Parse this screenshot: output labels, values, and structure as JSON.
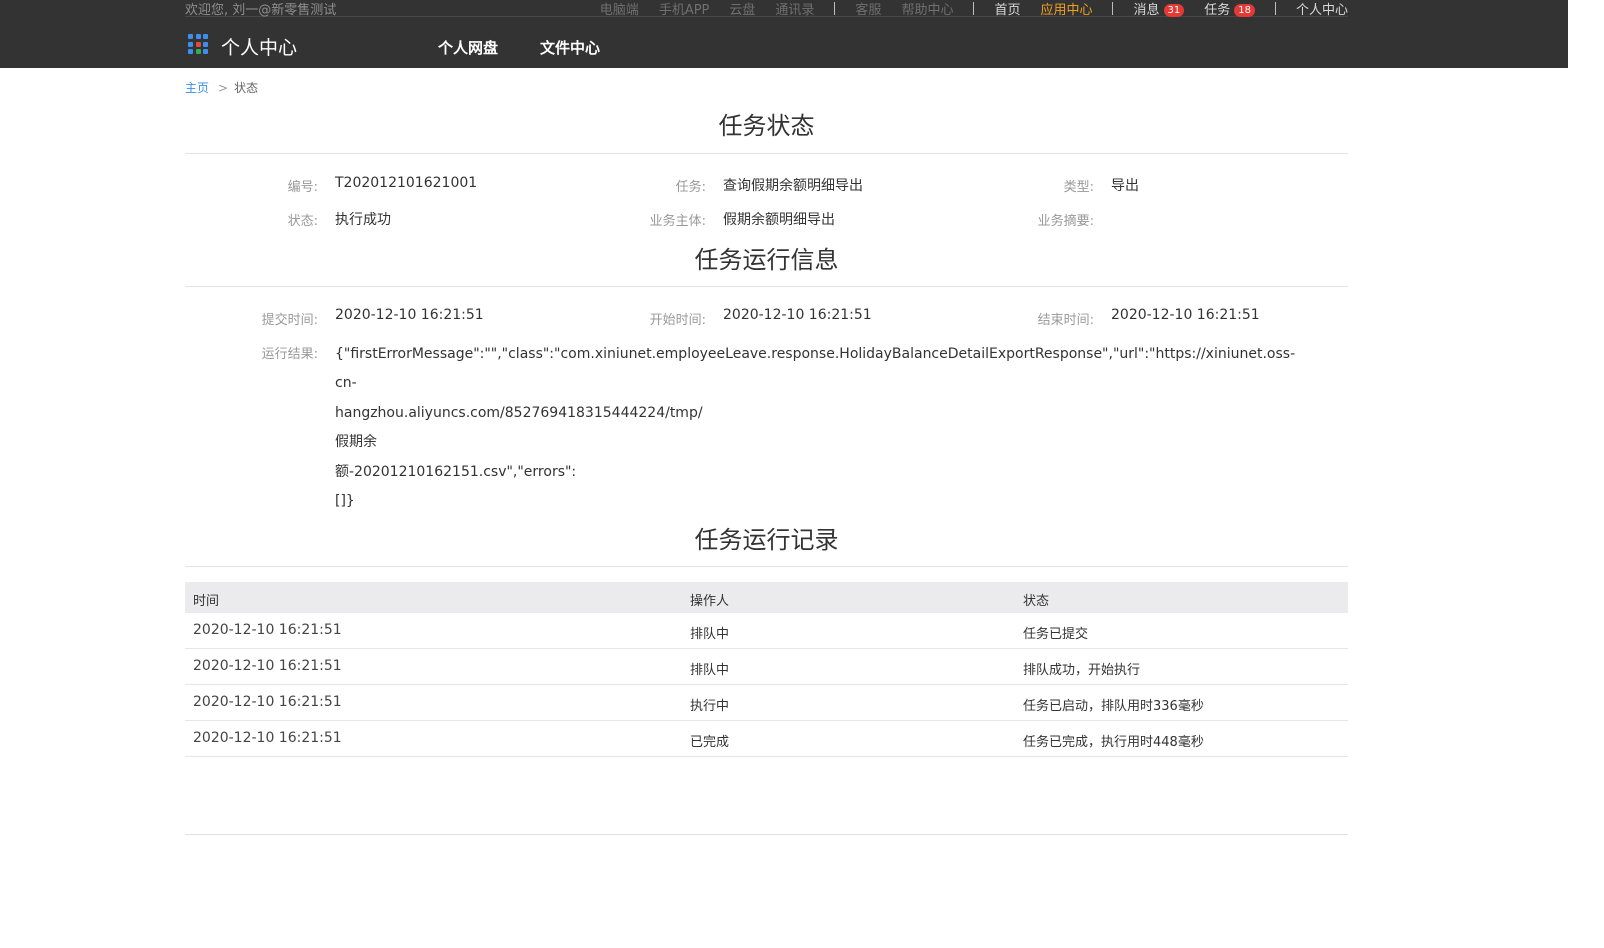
{
  "topbar": {
    "welcome": "欢迎您, 刘一@新零售测试",
    "links": {
      "desktop": "电脑端",
      "mobile_app": "手机APP",
      "cloud_disk": "云盘",
      "contacts": "通讯录",
      "service": "客服",
      "help": "帮助中心",
      "home": "首页",
      "app_center": "应用中心",
      "messages": "消息",
      "messages_count": "31",
      "tasks": "任务",
      "tasks_count": "18",
      "personal_center": "个人中心"
    },
    "accent_color": "#f0a020",
    "badge_color": "#e53935"
  },
  "navbar": {
    "brand": "个人中心",
    "logo_icon": "app-grid-icon",
    "items": [
      "个人网盘",
      "文件中心"
    ]
  },
  "breadcrumb": {
    "home": "主页",
    "separator": ">",
    "current": "状态"
  },
  "task_status": {
    "title": "任务状态",
    "id_label": "编号:",
    "id_value": "T202012101621001",
    "task_label": "任务:",
    "task_value": "查询假期余额明细导出",
    "type_label": "类型:",
    "type_value": "导出",
    "status_label": "状态:",
    "status_value": "执行成功",
    "subject_label": "业务主体:",
    "subject_value": "假期余额明细导出",
    "summary_label": "业务摘要:",
    "summary_value": ""
  },
  "run_info": {
    "title": "任务运行信息",
    "submit_label": "提交时间:",
    "submit_value": "2020-12-10 16:21:51",
    "start_label": "开始时间:",
    "start_value": "2020-12-10 16:21:51",
    "end_label": "结束时间:",
    "end_value": "2020-12-10 16:21:51",
    "result_label": "运行结果:",
    "result_lines": [
      "{\"firstErrorMessage\":\"\",\"class\":\"com.xiniunet.employeeLeave.response.HolidayBalanceDetailExportResponse\",\"url\":\"https://xiniunet.oss-",
      "cn-",
      "hangzhou.aliyuncs.com/852769418315444224/tmp/",
      "假期余",
      "额-20201210162151.csv\",\"errors\":",
      "[]}"
    ]
  },
  "run_log": {
    "title": "任务运行记录",
    "columns": [
      "时间",
      "操作人",
      "状态"
    ],
    "rows": [
      [
        "2020-12-10 16:21:51",
        "排队中",
        "任务已提交"
      ],
      [
        "2020-12-10 16:21:51",
        "排队中",
        "排队成功，开始执行"
      ],
      [
        "2020-12-10 16:21:51",
        "执行中",
        "任务已启动，排队用时336毫秒"
      ],
      [
        "2020-12-10 16:21:51",
        "已完成",
        "任务已完成，执行用时448毫秒"
      ]
    ]
  }
}
